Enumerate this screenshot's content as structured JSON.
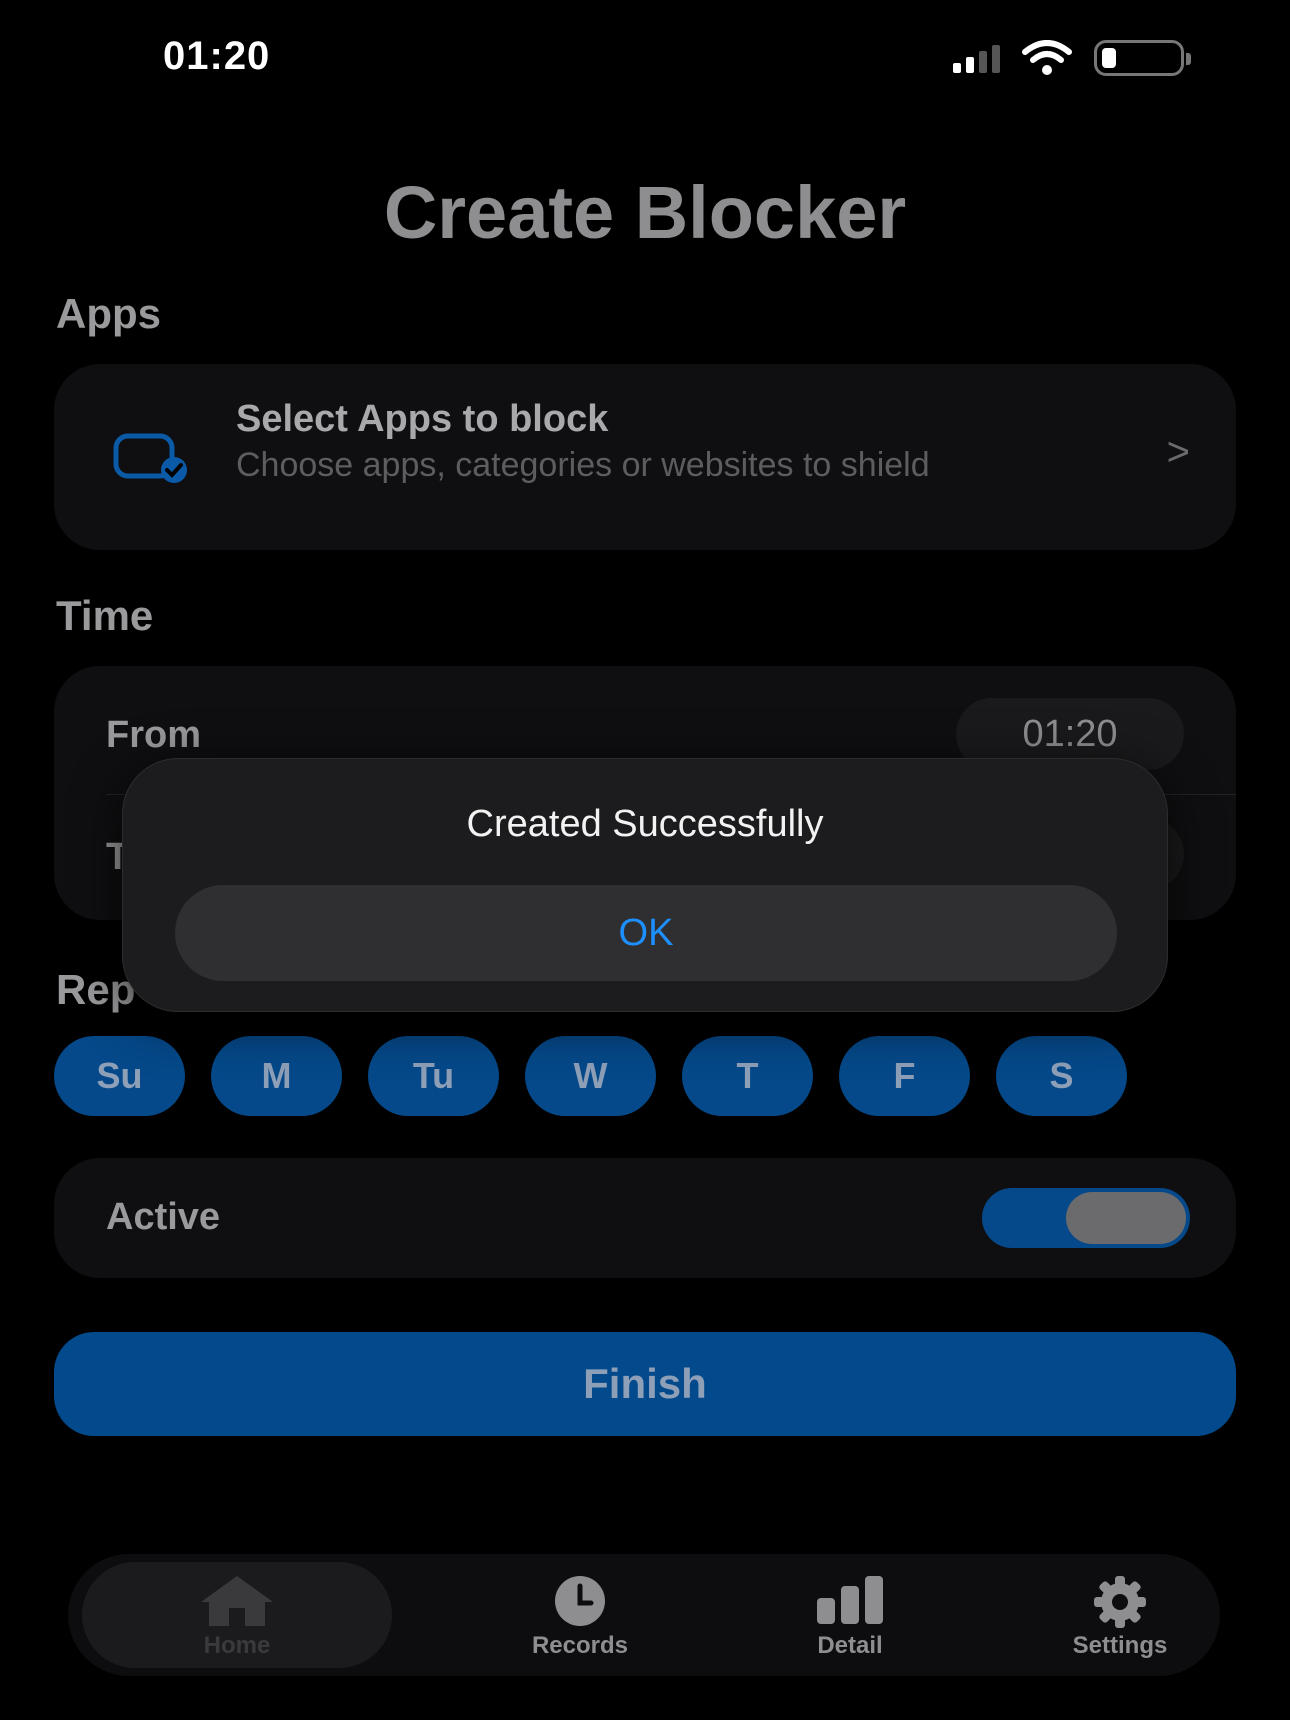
{
  "status_bar": {
    "time": "01:20"
  },
  "header": {
    "title": "Create Blocker"
  },
  "apps_section": {
    "label": "Apps",
    "title": "Select Apps to block",
    "subtitle": "Choose apps, categories or websites to shield"
  },
  "time_section": {
    "label": "Time",
    "from_label": "From",
    "from_value": "01:20",
    "to_label": "T"
  },
  "repeat_section": {
    "label": "Rep",
    "days": [
      "Su",
      "M",
      "Tu",
      "W",
      "T",
      "F",
      "S"
    ]
  },
  "active": {
    "label": "Active",
    "enabled": true
  },
  "finish_button": "Finish",
  "tab_bar": {
    "tabs": [
      {
        "label": "Home",
        "icon": "home-icon",
        "selected": true
      },
      {
        "label": "Records",
        "icon": "clock-icon",
        "selected": false
      },
      {
        "label": "Detail",
        "icon": "bar-chart-icon",
        "selected": false
      },
      {
        "label": "Settings",
        "icon": "gear-icon",
        "selected": false
      }
    ]
  },
  "alert": {
    "title": "Created Successfully",
    "ok_label": "OK"
  },
  "colors": {
    "accent": "#05498a",
    "link_blue": "#1e8fff",
    "background": "#000000"
  }
}
